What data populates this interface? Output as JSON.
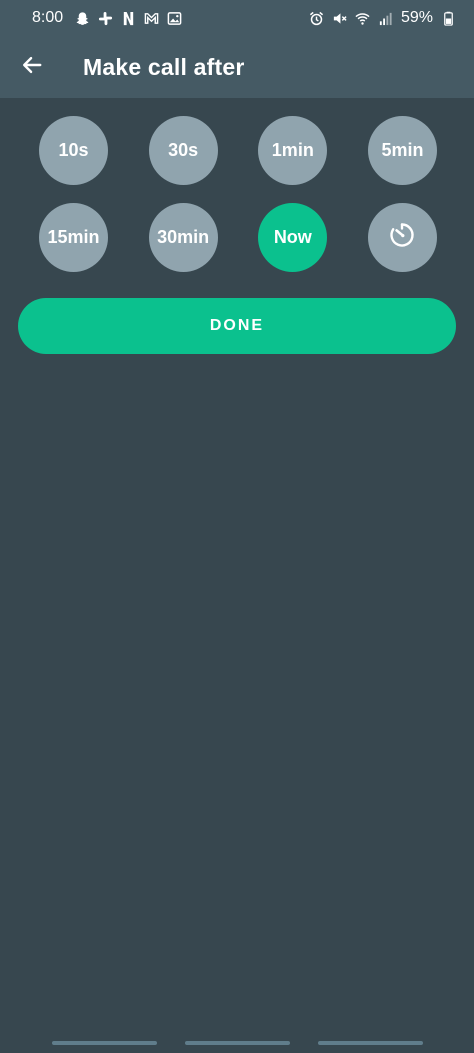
{
  "status_bar": {
    "time": "8:00",
    "battery": "59%",
    "left_icons": [
      "snapchat-icon",
      "slack-icon",
      "netflix-icon",
      "gmail-icon",
      "gallery-icon"
    ],
    "right_icons": [
      "alarm-icon",
      "mute-icon",
      "wifi-icon",
      "signal-icon",
      "battery-icon"
    ]
  },
  "header": {
    "title": "Make call after",
    "back_icon": "arrow-left-icon"
  },
  "options": {
    "row1": [
      "10s",
      "30s",
      "1min",
      "5min"
    ],
    "row2": [
      "15min",
      "30min",
      "Now"
    ],
    "selected": "Now",
    "custom_icon": "timer-icon"
  },
  "done_label": "DONE",
  "colors": {
    "background": "#37474f",
    "header": "#455a64",
    "option": "#90a4ae",
    "accent": "#0bc18e"
  }
}
